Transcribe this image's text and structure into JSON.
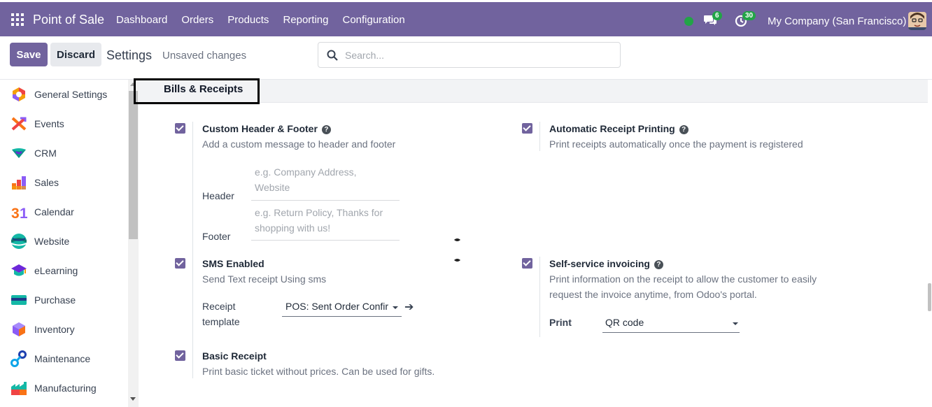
{
  "topbar": {
    "app_name": "Point of Sale",
    "menu": [
      "Dashboard",
      "Orders",
      "Products",
      "Reporting",
      "Configuration"
    ],
    "messages_count": "6",
    "activities_count": "30",
    "company": "My Company (San Francisco)"
  },
  "controlbar": {
    "save_label": "Save",
    "discard_label": "Discard",
    "title": "Settings",
    "status": "Unsaved changes",
    "search_placeholder": "Search..."
  },
  "sidebar": {
    "items": [
      {
        "label": "General Settings",
        "icon": "general-settings-icon"
      },
      {
        "label": "Events",
        "icon": "events-icon"
      },
      {
        "label": "CRM",
        "icon": "crm-icon"
      },
      {
        "label": "Sales",
        "icon": "sales-icon"
      },
      {
        "label": "Calendar",
        "icon": "calendar-icon"
      },
      {
        "label": "Website",
        "icon": "website-icon"
      },
      {
        "label": "eLearning",
        "icon": "elearning-icon"
      },
      {
        "label": "Purchase",
        "icon": "purchase-icon"
      },
      {
        "label": "Inventory",
        "icon": "inventory-icon"
      },
      {
        "label": "Maintenance",
        "icon": "maintenance-icon"
      },
      {
        "label": "Manufacturing",
        "icon": "manufacturing-icon"
      }
    ]
  },
  "section": {
    "title": "Bills & Receipts"
  },
  "options": {
    "header_footer": {
      "title": "Custom Header & Footer",
      "desc": "Add a custom message to header and footer",
      "header_label": "Header",
      "header_placeholder_1": "e.g. Company Address,",
      "header_placeholder_2": "Website",
      "footer_label": "Footer",
      "footer_placeholder_1": "e.g. Return Policy, Thanks for",
      "footer_placeholder_2": "shopping with us!"
    },
    "auto_print": {
      "title": "Automatic Receipt Printing",
      "desc": "Print receipts automatically once the payment is registered"
    },
    "sms": {
      "title": "SMS Enabled",
      "desc": "Send Text receipt Using sms",
      "template_label_1": "Receipt",
      "template_label_2": "template",
      "template_value": "POS: Sent Order Confir"
    },
    "self_invoice": {
      "title": "Self-service invoicing",
      "desc_1": "Print information on the receipt to allow the customer to easily",
      "desc_2": "request the invoice anytime, from Odoo's portal.",
      "print_label": "Print",
      "print_value": "QR code"
    },
    "basic_receipt": {
      "title": "Basic Receipt",
      "desc": "Print basic ticket without prices. Can be used for gifts."
    }
  },
  "colors": {
    "brand": "#71639e",
    "online": "#22a447"
  }
}
